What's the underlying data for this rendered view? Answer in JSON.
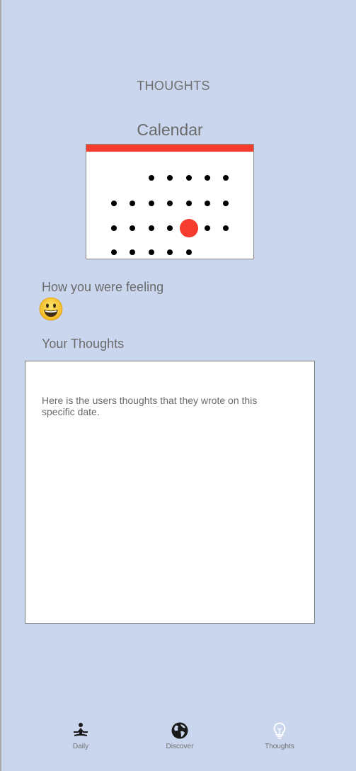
{
  "header": {
    "title": "THOUGHTS"
  },
  "calendar": {
    "heading": "Calendar",
    "accent_color": "#f53c2f",
    "selected_day_color": "#f53c2f"
  },
  "feeling": {
    "label": "How you were feeling",
    "emoji": "grinning-face-emoji"
  },
  "thoughts": {
    "label": "Your Thoughts",
    "text": "Here is the users thoughts that they wrote on this specific date."
  },
  "tabs": [
    {
      "label": "Daily",
      "icon": "meditation-icon",
      "active": false
    },
    {
      "label": "Discover",
      "icon": "globe-icon",
      "active": false
    },
    {
      "label": "Thoughts",
      "icon": "lightbulb-icon",
      "active": true
    }
  ],
  "colors": {
    "background": "#cad6ee",
    "panel": "#ffffff",
    "text": "#6a6a6a"
  }
}
